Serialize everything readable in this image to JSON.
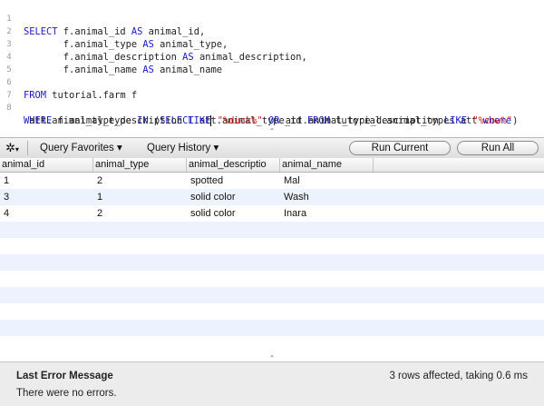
{
  "editor": {
    "lines": [
      {
        "n": "1",
        "code": "SELECT f.animal_id AS animal_id,"
      },
      {
        "n": "2",
        "code": "       f.animal_type AS animal_type,"
      },
      {
        "n": "3",
        "code": "       f.animal_description AS animal_description,"
      },
      {
        "n": "4",
        "code": "       f.animal_name AS animal_name"
      },
      {
        "n": "5",
        "code": ""
      },
      {
        "n": "6",
        "code": "FROM tutorial.farm f"
      },
      {
        "n": "7",
        "code": ""
      },
      {
        "n": "8",
        "code": "WHERE f.animal_type IN (SELECT att.animal_type_id FROM tutorial.animal_types att where"
      },
      {
        "n": "",
        "code": " att.animal_type_description LIKE \"%duck%\" OR att.animal_type_description LIKE \"%cow%\")"
      }
    ]
  },
  "toolbar": {
    "gear_icon": "gear-icon",
    "favorites_label": "Query Favorites",
    "history_label": "Query History",
    "run_current_label": "Run Current",
    "run_all_label": "Run All",
    "dropdown_glyph": "▾",
    "gear_glyph": "✲"
  },
  "grid": {
    "columns": [
      "animal_id",
      "animal_type",
      "animal_descriptio",
      "animal_name"
    ],
    "rows": [
      [
        "1",
        "2",
        "spotted",
        "Mal"
      ],
      [
        "3",
        "1",
        "solid color",
        "Wash"
      ],
      [
        "4",
        "2",
        "solid color",
        "Inara"
      ]
    ]
  },
  "status": {
    "title": "Last Error Message",
    "message": "There were no errors.",
    "summary": "3 rows affected, taking 0.6 ms"
  },
  "colors": {
    "keyword": "#1a1ac8",
    "string": "#c8141e",
    "alt_row": "#edf3fe"
  }
}
